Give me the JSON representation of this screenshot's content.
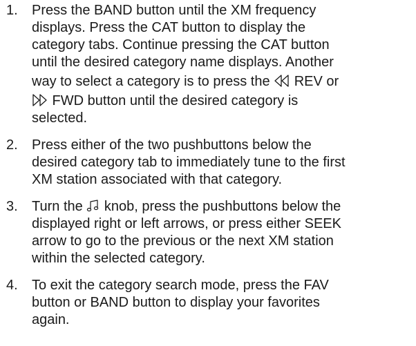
{
  "steps": [
    {
      "number": "1.",
      "lines": [
        "Press the BAND button until the XM frequency",
        "displays. Press the CAT button to display the",
        "category tabs. Continue pressing the CAT button",
        "until the desired category name displays. Another",
        {
          "before": "way to select a category is to press the ",
          "icon": "rewind-icon",
          "after": " REV or"
        },
        {
          "before": "",
          "icon": "fast-forward-icon",
          "after": " FWD button until the desired category is"
        },
        "selected."
      ]
    },
    {
      "number": "2.",
      "lines": [
        "Press either of the two pushbuttons below the",
        "desired category tab to immediately tune to the first",
        "XM station associated with that category."
      ]
    },
    {
      "number": "3.",
      "lines": [
        {
          "before": "Turn the ",
          "icon": "music-note-icon",
          "after": " knob, press the pushbuttons below the"
        },
        "displayed right or left arrows, or press either SEEK",
        "arrow to go to the previous or the next XM station",
        "within the selected category."
      ]
    },
    {
      "number": "4.",
      "lines": [
        "To exit the category search mode, press the FAV",
        "button or BAND button to display your favorites",
        "again."
      ]
    }
  ]
}
